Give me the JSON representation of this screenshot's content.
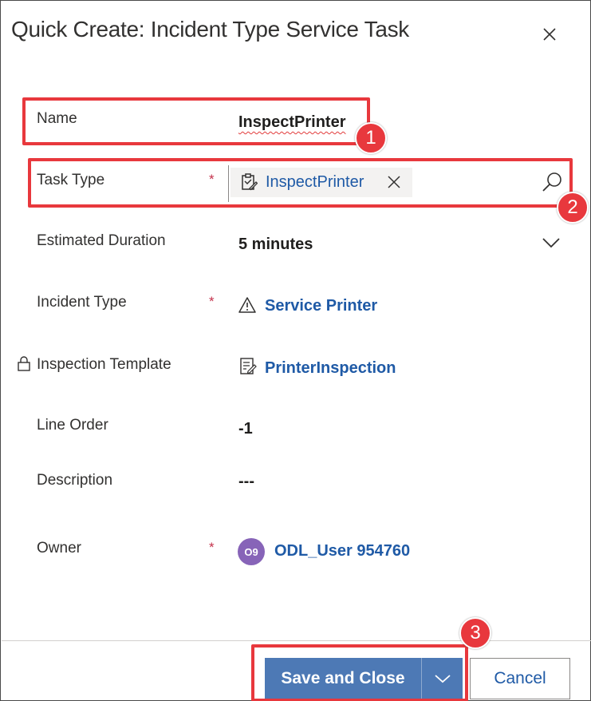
{
  "dialog": {
    "title": "Quick Create: Incident Type Service Task"
  },
  "fields": {
    "name": {
      "label": "Name",
      "value": "InspectPrinter"
    },
    "task_type": {
      "label": "Task Type",
      "required_mark": "*",
      "value": "InspectPrinter"
    },
    "estimated_duration": {
      "label": "Estimated Duration",
      "value": "5 minutes"
    },
    "incident_type": {
      "label": "Incident Type",
      "required_mark": "*",
      "value": "Service Printer"
    },
    "inspection_template": {
      "label": "Inspection Template",
      "value": "PrinterInspection"
    },
    "line_order": {
      "label": "Line Order",
      "value": "-1"
    },
    "description": {
      "label": "Description",
      "value": "---"
    },
    "owner": {
      "label": "Owner",
      "required_mark": "*",
      "initials": "O9",
      "value": "ODL_User 954760"
    }
  },
  "footer": {
    "save_label": "Save and Close",
    "cancel_label": "Cancel"
  },
  "callouts": [
    "1",
    "2",
    "3"
  ],
  "icons": {
    "close": "close-icon",
    "task_type": "task-type-icon",
    "clear": "clear-icon",
    "search": "search-icon",
    "chevron": "chevron-down-icon",
    "warning": "warning-icon",
    "template": "template-icon",
    "lock": "lock-icon"
  },
  "colors": {
    "accent": "#4d79b5",
    "link": "#1f5aa6",
    "required": "#c4314b",
    "avatar": "#8764b8",
    "callout": "#e8383d"
  }
}
